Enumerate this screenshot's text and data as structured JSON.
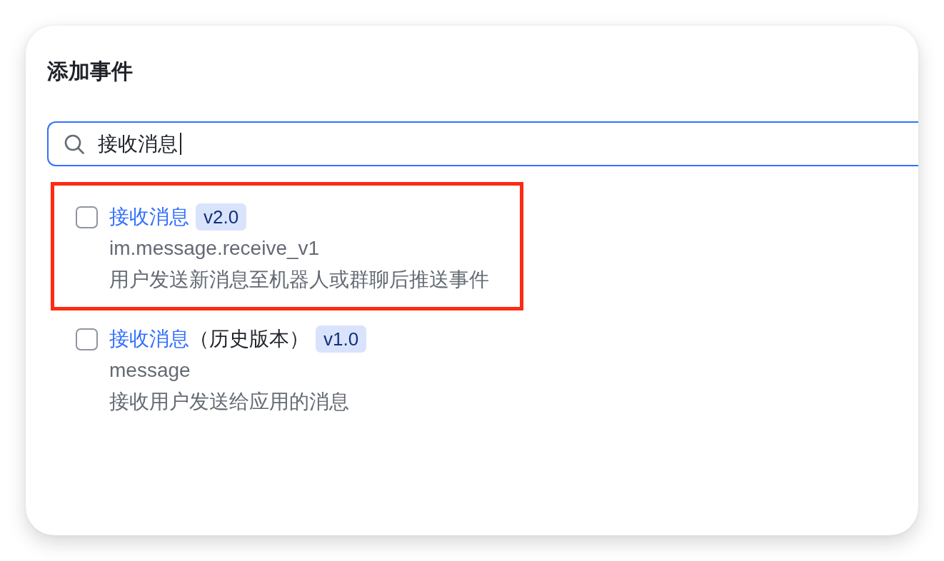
{
  "dialog": {
    "title": "添加事件"
  },
  "search": {
    "value": "接收消息",
    "focused": true
  },
  "events": [
    {
      "title": "接收消息",
      "version": "v2.0",
      "key": "im.message.receive_v1",
      "description": "用户发送新消息至机器人或群聊后推送事件",
      "checked": false,
      "highlighted": true
    },
    {
      "title": "接收消息",
      "title_suffix": "（历史版本）",
      "version": "v1.0",
      "key": "message",
      "description": "接收用户发送给应用的消息",
      "checked": false,
      "highlighted": false
    }
  ]
}
